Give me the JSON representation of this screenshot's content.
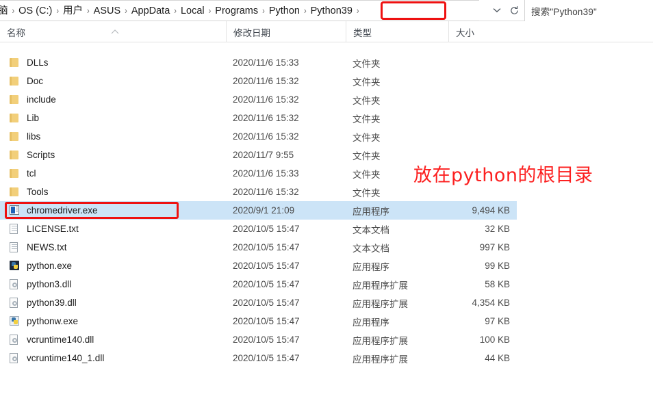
{
  "addressbar": {
    "crumbs": [
      "脑",
      "OS (C:)",
      "用户",
      "ASUS",
      "AppData",
      "Local",
      "Programs",
      "Python",
      "Python39"
    ],
    "separator": "›",
    "dropdown_icon": "chevron-down-icon",
    "refresh_icon": "refresh-icon",
    "highlight_color": "#ee1111"
  },
  "search": {
    "placeholder": "搜索\"Python39\"",
    "value": ""
  },
  "columns": [
    {
      "label": "名称"
    },
    {
      "label": "修改日期"
    },
    {
      "label": "类型"
    },
    {
      "label": "大小"
    }
  ],
  "sort": {
    "column": "名称",
    "direction": "ascending",
    "icon": "sort-ascending-icon"
  },
  "files": [
    {
      "name": "DLLs",
      "date": "2020/11/6 15:33",
      "type": "文件夹",
      "size": "",
      "icon": "folder-icon",
      "selected": false
    },
    {
      "name": "Doc",
      "date": "2020/11/6 15:32",
      "type": "文件夹",
      "size": "",
      "icon": "folder-icon",
      "selected": false
    },
    {
      "name": "include",
      "date": "2020/11/6 15:32",
      "type": "文件夹",
      "size": "",
      "icon": "folder-icon",
      "selected": false
    },
    {
      "name": "Lib",
      "date": "2020/11/6 15:32",
      "type": "文件夹",
      "size": "",
      "icon": "folder-icon",
      "selected": false
    },
    {
      "name": "libs",
      "date": "2020/11/6 15:32",
      "type": "文件夹",
      "size": "",
      "icon": "folder-icon",
      "selected": false
    },
    {
      "name": "Scripts",
      "date": "2020/11/7 9:55",
      "type": "文件夹",
      "size": "",
      "icon": "folder-icon",
      "selected": false
    },
    {
      "name": "tcl",
      "date": "2020/11/6 15:33",
      "type": "文件夹",
      "size": "",
      "icon": "folder-icon",
      "selected": false
    },
    {
      "name": "Tools",
      "date": "2020/11/6 15:32",
      "type": "文件夹",
      "size": "",
      "icon": "folder-icon",
      "selected": false
    },
    {
      "name": "chromedriver.exe",
      "date": "2020/9/1 21:09",
      "type": "应用程序",
      "size": "9,494 KB",
      "icon": "exe-blue-icon",
      "selected": true
    },
    {
      "name": "LICENSE.txt",
      "date": "2020/10/5 15:47",
      "type": "文本文档",
      "size": "32 KB",
      "icon": "text-doc-icon",
      "selected": false
    },
    {
      "name": "NEWS.txt",
      "date": "2020/10/5 15:47",
      "type": "文本文档",
      "size": "997 KB",
      "icon": "text-doc-icon",
      "selected": false
    },
    {
      "name": "python.exe",
      "date": "2020/10/5 15:47",
      "type": "应用程序",
      "size": "99 KB",
      "icon": "python-exe-icon",
      "selected": false
    },
    {
      "name": "python3.dll",
      "date": "2020/10/5 15:47",
      "type": "应用程序扩展",
      "size": "58 KB",
      "icon": "dll-icon",
      "selected": false
    },
    {
      "name": "python39.dll",
      "date": "2020/10/5 15:47",
      "type": "应用程序扩展",
      "size": "4,354 KB",
      "icon": "dll-icon",
      "selected": false
    },
    {
      "name": "pythonw.exe",
      "date": "2020/10/5 15:47",
      "type": "应用程序",
      "size": "97 KB",
      "icon": "pythonw-exe-icon",
      "selected": false
    },
    {
      "name": "vcruntime140.dll",
      "date": "2020/10/5 15:47",
      "type": "应用程序扩展",
      "size": "100 KB",
      "icon": "dll-icon",
      "selected": false
    },
    {
      "name": "vcruntime140_1.dll",
      "date": "2020/10/5 15:47",
      "type": "应用程序扩展",
      "size": "44 KB",
      "icon": "dll-icon",
      "selected": false
    }
  ],
  "annotations": {
    "note_text": "放在python的根目录",
    "note_color": "#fc2020",
    "highlighted_file": "chromedriver.exe",
    "highlighted_breadcrumb": "Python39"
  }
}
